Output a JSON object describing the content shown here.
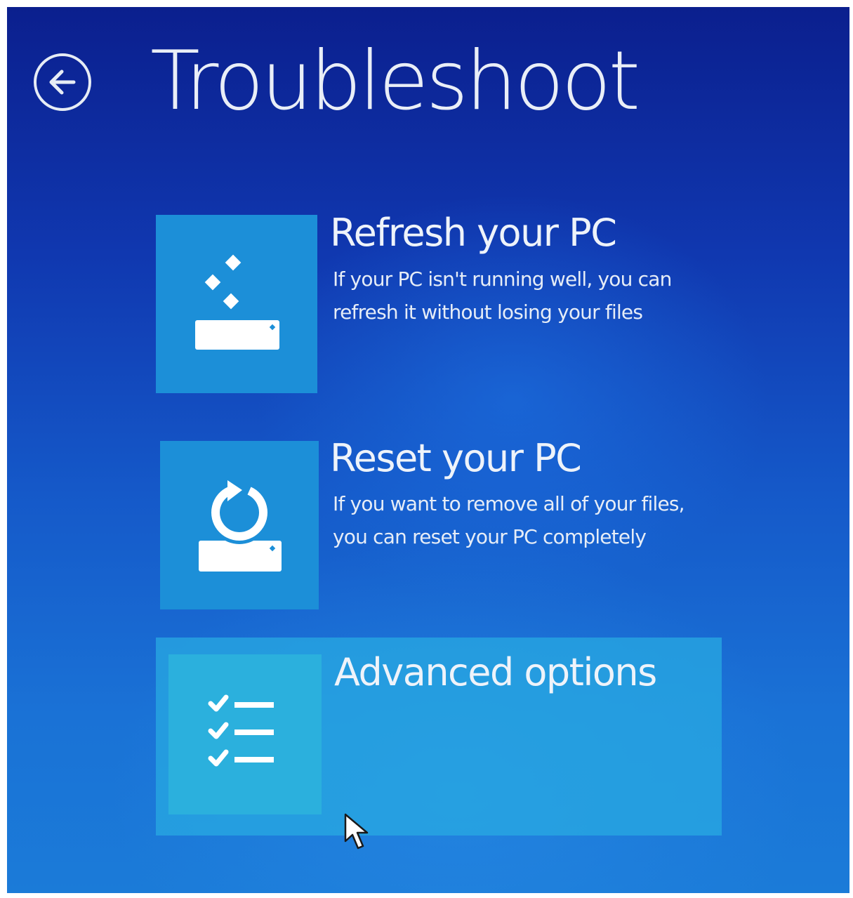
{
  "header": {
    "title": "Troubleshoot",
    "back_icon": "back-arrow-icon"
  },
  "options": [
    {
      "title": "Refresh your PC",
      "description_line1": "If your PC isn't running well, you can",
      "description_line2": "refresh it without losing your files",
      "icon": "refresh-pc-icon",
      "selected": false
    },
    {
      "title": "Reset your PC",
      "description_line1": "If you want to remove all of your files,",
      "description_line2": "you can reset your PC completely",
      "icon": "reset-pc-icon",
      "selected": false
    },
    {
      "title": "Advanced options",
      "icon": "checklist-icon",
      "selected": true
    }
  ],
  "colors": {
    "background_top": "#0b1f8e",
    "background_bottom": "#1b7bd8",
    "tile": "#1c8fd8",
    "tile_selected": "#2bb0dd",
    "text": "#eef3fa"
  }
}
